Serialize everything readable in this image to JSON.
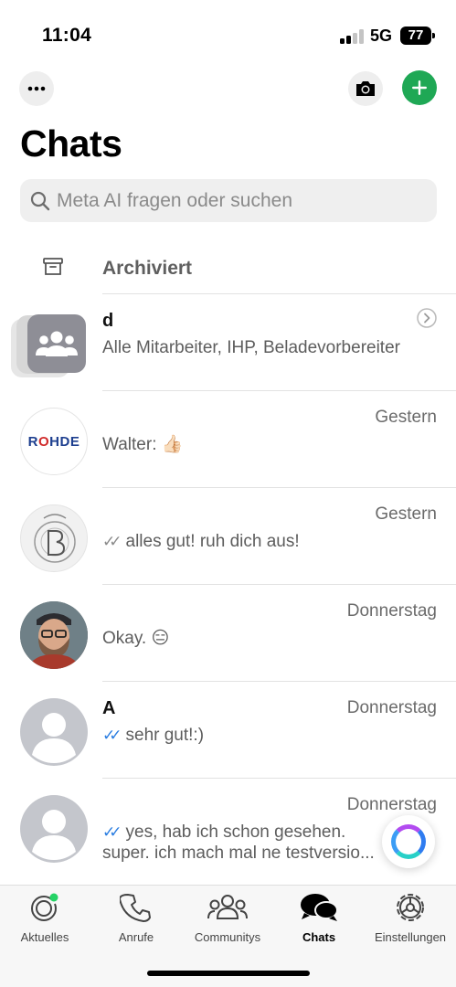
{
  "status_bar": {
    "time": "11:04",
    "network": "5G",
    "battery": "77"
  },
  "header": {
    "title": "Chats",
    "more_icon": "ellipsis-icon",
    "camera_icon": "camera-icon",
    "new_chat_icon": "plus-icon"
  },
  "search": {
    "placeholder": "Meta AI fragen oder suchen"
  },
  "archived": {
    "label": "Archiviert"
  },
  "chats": [
    {
      "name": "d",
      "preview": "Alle Mitarbeiter, IHP, Beladevorbereiter",
      "time": "",
      "avatar": "group"
    },
    {
      "name": "",
      "preview": "Walter: 👍🏻",
      "time": "Gestern",
      "avatar": "ROHDE"
    },
    {
      "name": "",
      "preview": "alles gut! ruh dich aus!",
      "time": "Gestern",
      "avatar": "sketch",
      "tick": "✓✓"
    },
    {
      "name": "",
      "preview": "Okay. 😑",
      "time": "Donnerstag",
      "avatar": "photo"
    },
    {
      "name": "A",
      "preview": "sehr gut!:)",
      "time": "Donnerstag",
      "avatar": "default",
      "tick": "✓✓"
    },
    {
      "name": "",
      "preview": "yes, hab ich schon gesehen.",
      "preview_line2": "super. ich mach mal ne testversio...",
      "time": "Donnerstag",
      "avatar": "default",
      "tick": "✓✓"
    }
  ],
  "tabs": [
    {
      "label": "Aktuelles",
      "icon": "status-icon"
    },
    {
      "label": "Anrufe",
      "icon": "phone-icon"
    },
    {
      "label": "Communitys",
      "icon": "communities-icon"
    },
    {
      "label": "Chats",
      "icon": "chats-icon",
      "active": true
    },
    {
      "label": "Einstellungen",
      "icon": "gear-icon"
    }
  ],
  "colors": {
    "accent": "#1fa855",
    "read_tick": "#2a7de1",
    "unread_dot": "#25d366"
  }
}
